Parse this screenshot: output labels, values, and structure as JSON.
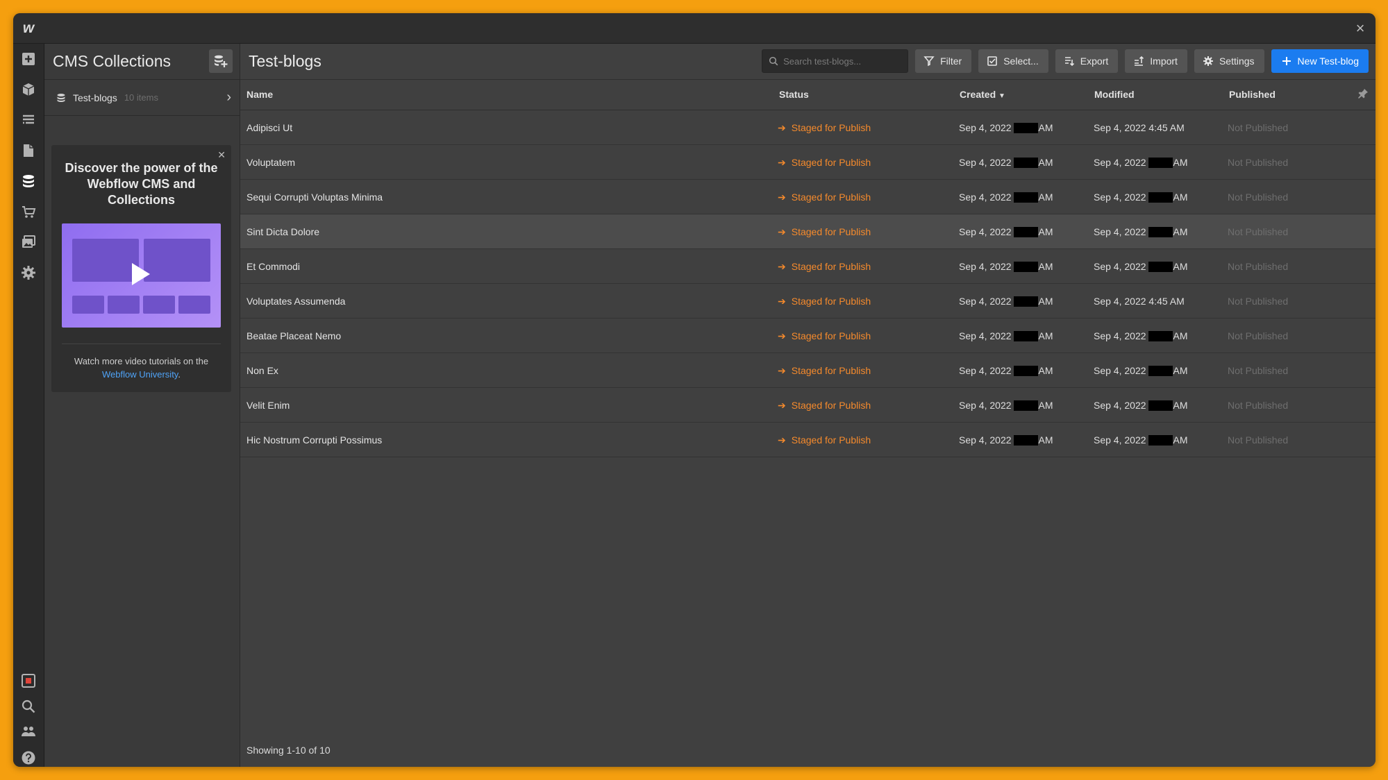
{
  "app": {
    "logo": "w",
    "close": "×"
  },
  "rail": {
    "icons": [
      "add-icon",
      "box-icon",
      "navigator-icon",
      "pages-icon",
      "database-icon",
      "cart-icon",
      "assets-icon",
      "gear-icon",
      "record-icon",
      "search-icon",
      "users-icon",
      "help-icon"
    ]
  },
  "sidebar": {
    "title": "CMS Collections",
    "collection": {
      "name": "Test-blogs",
      "count": "10 items"
    },
    "promo": {
      "title": "Discover the power of the Webflow CMS and Collections",
      "text_before": "Watch more video tutorials on the",
      "link": "Webflow University",
      "text_after": "."
    }
  },
  "main": {
    "title": "Test-blogs",
    "search_placeholder": "Search test-blogs...",
    "buttons": {
      "filter": "Filter",
      "select": "Select...",
      "export": "Export",
      "import": "Import",
      "settings": "Settings",
      "new": "New Test-blog"
    },
    "columns": {
      "name": "Name",
      "status": "Status",
      "created": "Created",
      "modified": "Modified",
      "published": "Published"
    },
    "rows": [
      {
        "name": "Adipisci Ut",
        "status": "Staged for Publish",
        "created_date": "Sep 4, 2022",
        "created_suffix": "AM",
        "modified_date": "Sep 4, 2022 4:45 AM",
        "modified_suffix": "",
        "published": "Not Published"
      },
      {
        "name": "Voluptatem",
        "status": "Staged for Publish",
        "created_date": "Sep 4, 2022",
        "created_suffix": "AM",
        "modified_date": "Sep 4, 2022",
        "modified_suffix": "AM",
        "published": "Not Published"
      },
      {
        "name": "Sequi Corrupti Voluptas Minima",
        "status": "Staged for Publish",
        "created_date": "Sep 4, 2022",
        "created_suffix": "AM",
        "modified_date": "Sep 4, 2022",
        "modified_suffix": "AM",
        "published": "Not Published"
      },
      {
        "name": "Sint Dicta Dolore",
        "status": "Staged for Publish",
        "created_date": "Sep 4, 2022",
        "created_suffix": "AM",
        "modified_date": "Sep 4, 2022",
        "modified_suffix": "AM",
        "published": "Not Published"
      },
      {
        "name": "Et Commodi",
        "status": "Staged for Publish",
        "created_date": "Sep 4, 2022",
        "created_suffix": "AM",
        "modified_date": "Sep 4, 2022",
        "modified_suffix": "AM",
        "published": "Not Published"
      },
      {
        "name": "Voluptates Assumenda",
        "status": "Staged for Publish",
        "created_date": "Sep 4, 2022",
        "created_suffix": "AM",
        "modified_date": "Sep 4, 2022 4:45 AM",
        "modified_suffix": "",
        "published": "Not Published"
      },
      {
        "name": "Beatae Placeat Nemo",
        "status": "Staged for Publish",
        "created_date": "Sep 4, 2022",
        "created_suffix": "AM",
        "modified_date": "Sep 4, 2022",
        "modified_suffix": "AM",
        "published": "Not Published"
      },
      {
        "name": "Non Ex",
        "status": "Staged for Publish",
        "created_date": "Sep 4, 2022",
        "created_suffix": "AM",
        "modified_date": "Sep 4, 2022",
        "modified_suffix": "AM",
        "published": "Not Published"
      },
      {
        "name": "Velit Enim",
        "status": "Staged for Publish",
        "created_date": "Sep 4, 2022",
        "created_suffix": "AM",
        "modified_date": "Sep 4, 2022",
        "modified_suffix": "AM",
        "published": "Not Published"
      },
      {
        "name": "Hic Nostrum Corrupti Possimus",
        "status": "Staged for Publish",
        "created_date": "Sep 4, 2022",
        "created_suffix": "AM",
        "modified_date": "Sep 4, 2022",
        "modified_suffix": "AM",
        "published": "Not Published"
      }
    ],
    "highlighted_row": 3,
    "footer": "Showing 1-10 of 10"
  },
  "colors": {
    "accent": "#1b7cf0",
    "status": "#f58a2c",
    "frame": "#f59f0f"
  }
}
